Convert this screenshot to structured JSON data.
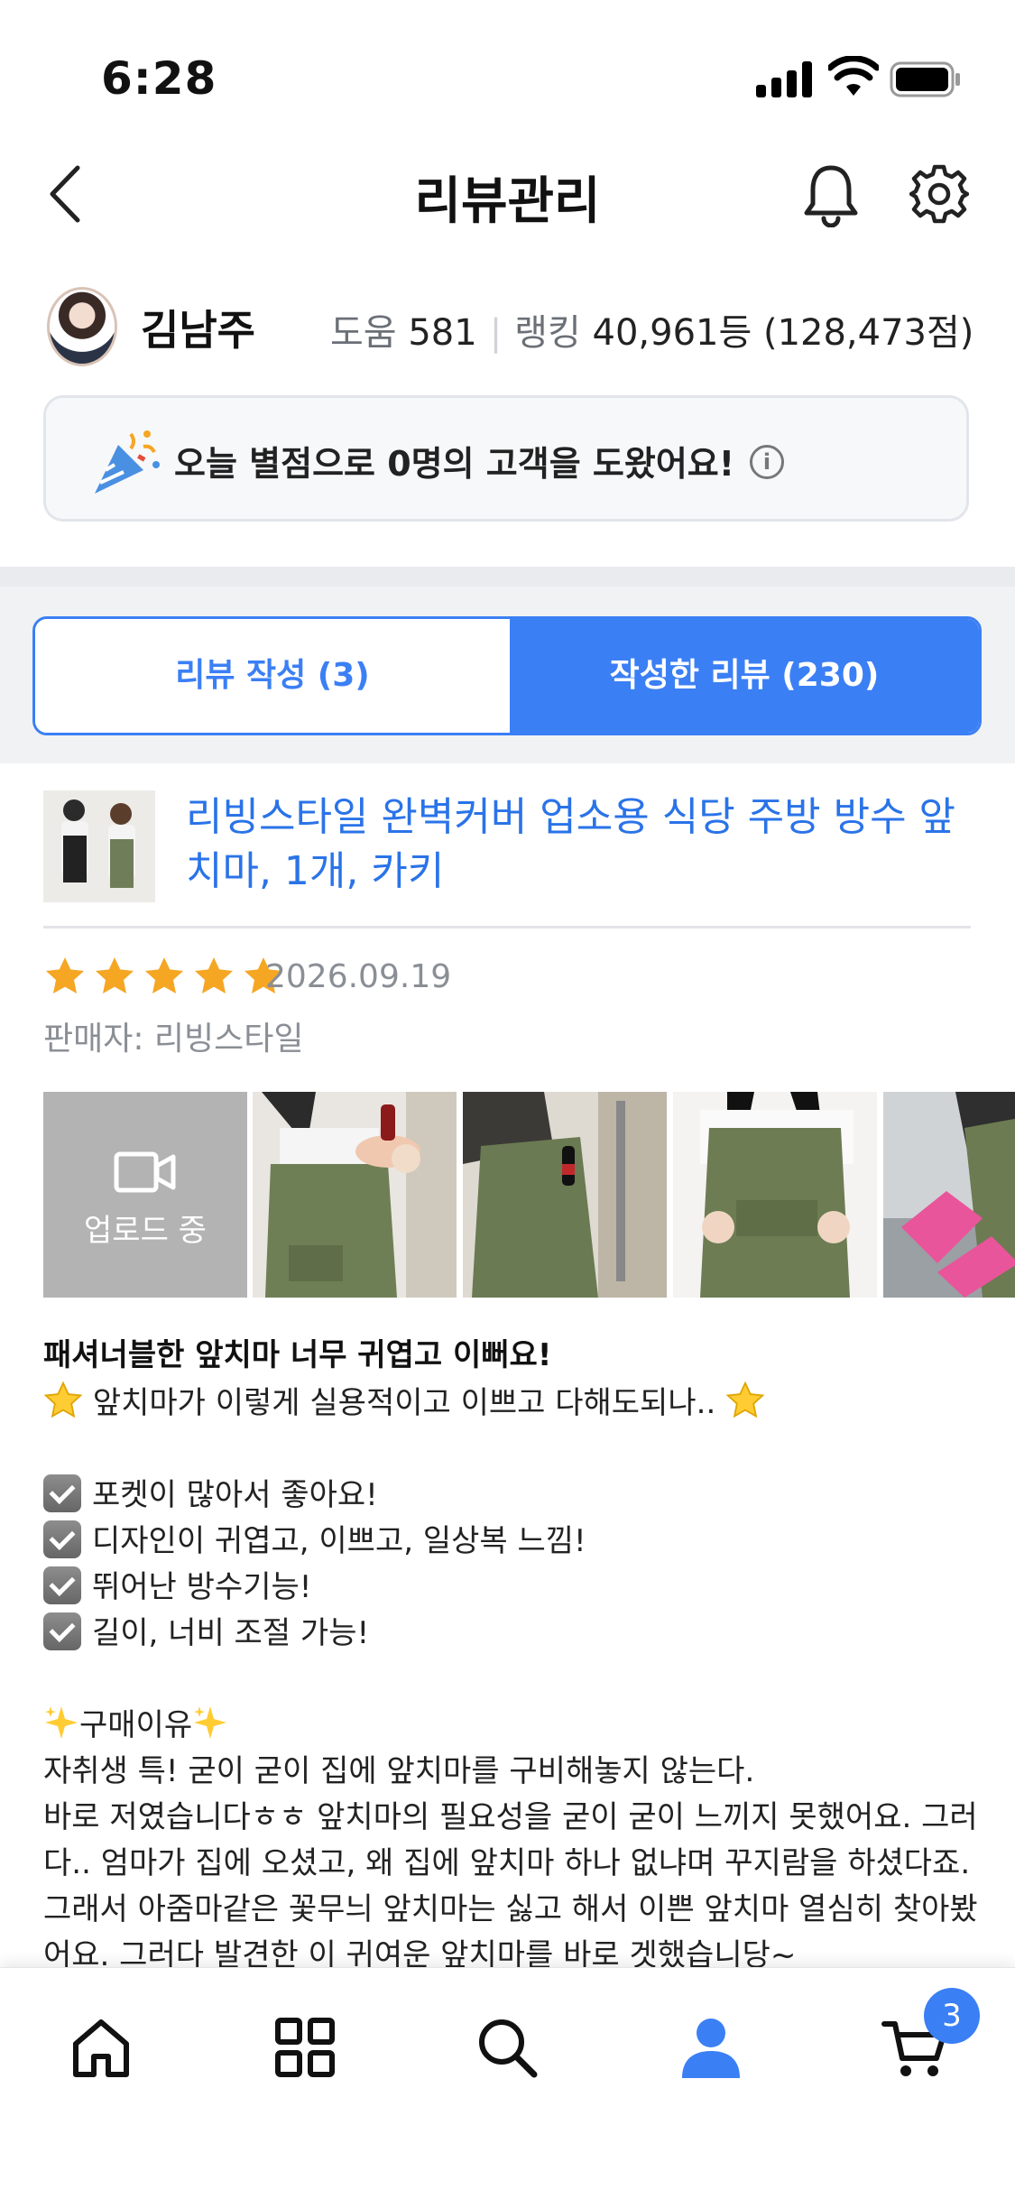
{
  "status_bar": {
    "time": "6:28"
  },
  "header": {
    "title": "리뷰관리"
  },
  "profile": {
    "name": "김남주",
    "help_label": "도움",
    "help_count": "581",
    "rank_label": "랭킹",
    "rank_value": "40,961등 (128,473점)"
  },
  "notice": {
    "text": "오늘 별점으로 0명의 고객을 도왔어요!",
    "info_glyph": "i"
  },
  "tabs": [
    {
      "label": "리뷰 작성 (3)",
      "active": false
    },
    {
      "label": "작성한 리뷰 (230)",
      "active": true
    }
  ],
  "product": {
    "name": "리빙스타일 완벽커버 업소용 식당 주방 방수 앞치마, 1개, 카키",
    "rating": 5,
    "date": "2026.09.19",
    "seller": "판매자: 리빙스타일"
  },
  "media": {
    "upload_label": "업로드 중",
    "photo_count": 4
  },
  "review": {
    "title": "패셔너블한 앞치마 너무 귀엽고 이뻐요!",
    "intro": "앞치마가 이렇게 실용적이고 이쁘고 다해도되나..",
    "checklist": [
      "포켓이 많아서 좋아요!",
      "디자인이 귀엽고, 이쁘고, 일상복 느낌!",
      "뛰어난 방수기능!",
      "길이, 너비 조절 가능!"
    ],
    "reason_heading": "구매이유",
    "lines": [
      "자취생 특! 굳이 굳이 집에 앞치마를 구비해놓지 않는다.",
      "바로 저였습니다ㅎㅎ 앞치마의 필요성을 굳이 굳이 느끼지 못했어요. 그러",
      "다.. 엄마가 집에 오셨고, 왜 집에 앞치마 하나 없냐며 꾸지람을 하셨다죠.",
      "그래서 아줌마같은 꽃무늬 앞치마는 싫고 해서 이쁜 앞치마 열심히 찾아봤",
      "어요. 그러다 발견한 이 귀여운 앞치마를 바로 겟했습니당~"
    ]
  },
  "bottom_nav": {
    "items": [
      "home-icon",
      "categories-icon",
      "search-icon",
      "profile-icon",
      "cart-icon"
    ],
    "active": "profile-icon",
    "cart_badge": "3"
  },
  "colors": {
    "accent": "#3b7ff5",
    "link": "#2a73e8",
    "star": "#f5a623"
  }
}
